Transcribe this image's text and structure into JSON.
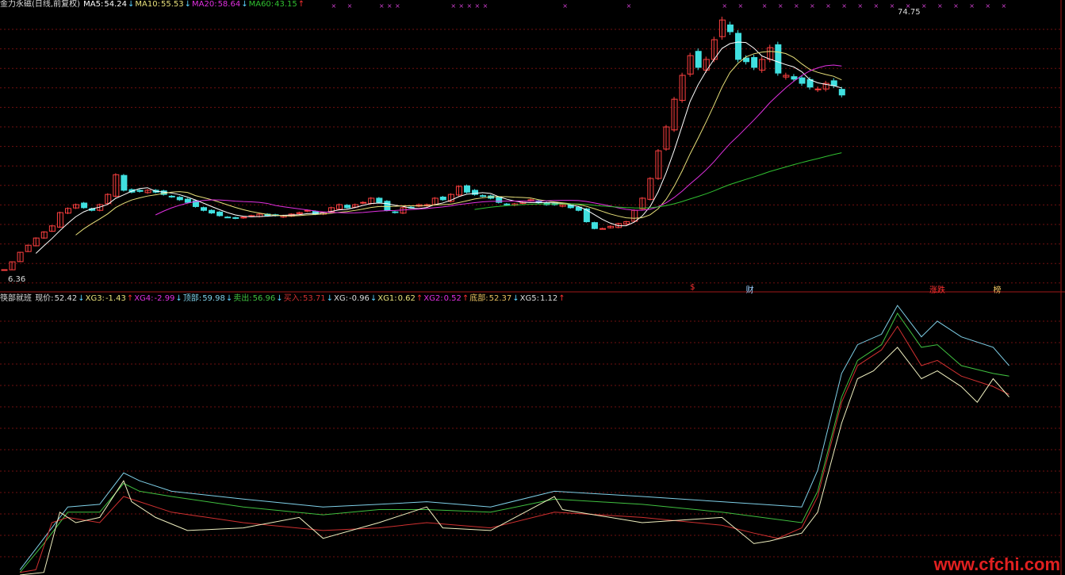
{
  "top_header": {
    "title": "金力永磁(日线,前复权)",
    "items": [
      {
        "label": "MA5:",
        "value": "54.24",
        "arrow": "↓",
        "color": "#ffffff",
        "arrow_color": "#5ad2ff"
      },
      {
        "label": "MA10:",
        "value": "55.53",
        "arrow": "↓",
        "color": "#e8e07a",
        "arrow_color": "#5ad2ff"
      },
      {
        "label": "MA20:",
        "value": "58.64",
        "arrow": "↓",
        "color": "#e030e0",
        "arrow_color": "#5ad2ff"
      },
      {
        "label": "MA60:",
        "value": "43.15",
        "arrow": "↑",
        "color": "#30c030",
        "arrow_color": "#ff3030"
      }
    ]
  },
  "bottom_header": {
    "title": "筷部就班",
    "items": [
      {
        "label": "现价:",
        "value": "52.42",
        "arrow": "↓",
        "color": "#dddddd",
        "arrow_color": "#5ad2ff"
      },
      {
        "label": "XG3:",
        "value": "-1.43",
        "arrow": "↑",
        "color": "#e8e07a",
        "arrow_color": "#ff3030"
      },
      {
        "label": "XG4:",
        "value": "-2.99",
        "arrow": "↓",
        "color": "#e030e0",
        "arrow_color": "#5ad2ff"
      },
      {
        "label": "顶部:",
        "value": "59.98",
        "arrow": "↓",
        "color": "#7fd0e8",
        "arrow_color": "#5ad2ff"
      },
      {
        "label": "卖出:",
        "value": "56.96",
        "arrow": "↓",
        "color": "#40c040",
        "arrow_color": "#5ad2ff"
      },
      {
        "label": "买入:",
        "value": "53.71",
        "arrow": "↓",
        "color": "#d03030",
        "arrow_color": "#5ad2ff"
      },
      {
        "label": "XG:",
        "value": "-0.96",
        "arrow": "↓",
        "color": "#dddddd",
        "arrow_color": "#5ad2ff"
      },
      {
        "label": "XG1:",
        "value": "0.62",
        "arrow": "↑",
        "color": "#e8e07a",
        "arrow_color": "#ff3030"
      },
      {
        "label": "XG2:",
        "value": "0.52",
        "arrow": "↑",
        "color": "#e030e0",
        "arrow_color": "#ff3030"
      },
      {
        "label": "底部:",
        "value": "52.37",
        "arrow": "↓",
        "color": "#e8c060",
        "arrow_color": "#5ad2ff"
      },
      {
        "label": "XG5:",
        "value": "1.12",
        "arrow": "↑",
        "color": "#dddddd",
        "arrow_color": "#ff3030"
      }
    ]
  },
  "tags": [
    {
      "text": "$",
      "color": "#ff3030",
      "index": 86
    },
    {
      "text": "财",
      "color": "#9fd0ff",
      "index": 93
    },
    {
      "text": "涨跌",
      "color": "#ff3030",
      "index": 116
    },
    {
      "text": "榜",
      "color": "#e8c060",
      "index": 124
    }
  ],
  "watermark": "www.cfchi.com",
  "chart_data": [
    {
      "type": "candlestick",
      "title": "金力永磁(日线,前复权)",
      "max_label": "74.75",
      "min_label": "6.36",
      "ylim": [
        6.36,
        74.75
      ],
      "closes": [
        6.36,
        8.43,
        10.94,
        12.8,
        14.7,
        16.3,
        17.9,
        21.4,
        22.5,
        23.5,
        22.7,
        22.0,
        23.5,
        26.2,
        31.4,
        27.3,
        26.8,
        27.0,
        27.3,
        26.8,
        26.2,
        25.6,
        24.8,
        24.1,
        23.0,
        22.0,
        21.3,
        20.6,
        20.2,
        19.9,
        20.2,
        20.6,
        21.0,
        20.6,
        20.6,
        20.6,
        21.0,
        21.4,
        22.0,
        21.0,
        21.4,
        22.7,
        23.5,
        22.7,
        23.5,
        24.1,
        25.2,
        24.1,
        22.0,
        21.4,
        22.7,
        22.7,
        23.5,
        23.5,
        25.2,
        24.8,
        26.2,
        28.3,
        26.8,
        26.2,
        25.8,
        25.2,
        24.1,
        23.5,
        23.7,
        24.1,
        24.8,
        24.0,
        23.5,
        23.5,
        23.5,
        22.7,
        22.0,
        19.0,
        17.2,
        17.2,
        17.8,
        18.5,
        19.0,
        22.0,
        25.2,
        30.4,
        37.7,
        44.0,
        51.3,
        57.6,
        62.8,
        59.7,
        61.8,
        67.0,
        72.2,
        69.1,
        61.8,
        61.2,
        59.7,
        61.8,
        64.9,
        58.2,
        57.6,
        56.6,
        55.5,
        54.5,
        54.0,
        55.5,
        54.9,
        52.42
      ],
      "series": [
        {
          "name": "MA5",
          "color": "#ffffff",
          "period": 5
        },
        {
          "name": "MA10",
          "color": "#e8e07a",
          "period": 10
        },
        {
          "name": "MA20",
          "color": "#e030e0",
          "period": 20
        },
        {
          "name": "MA60",
          "color": "#30c030",
          "period": 60
        }
      ]
    },
    {
      "type": "line",
      "title": "筷部就班",
      "ylim": [
        0,
        100
      ],
      "series": [
        {
          "name": "顶部",
          "color": "#7fd0e8",
          "points": [
            [
              2,
              2
            ],
            [
              5,
              14
            ],
            [
              8,
              26
            ],
            [
              12,
              27
            ],
            [
              15,
              39
            ],
            [
              17,
              36
            ],
            [
              21,
              32
            ],
            [
              30,
              29
            ],
            [
              40,
              26
            ],
            [
              47,
              27
            ],
            [
              53,
              28
            ],
            [
              61,
              26
            ],
            [
              69,
              32
            ],
            [
              80,
              30
            ],
            [
              90,
              28
            ],
            [
              100,
              26
            ],
            [
              102,
              40
            ],
            [
              105,
              77
            ],
            [
              107,
              88
            ],
            [
              110,
              92
            ],
            [
              112,
              103
            ],
            [
              115,
              91
            ],
            [
              117,
              97
            ],
            [
              120,
              91
            ],
            [
              124,
              87
            ],
            [
              126,
              80
            ]
          ]
        },
        {
          "name": "卖出",
          "color": "#40c040",
          "points": [
            [
              2,
              1
            ],
            [
              5,
              12
            ],
            [
              8,
              24
            ],
            [
              12,
              24
            ],
            [
              15,
              35
            ],
            [
              17,
              32
            ],
            [
              21,
              30
            ],
            [
              30,
              26
            ],
            [
              40,
              23
            ],
            [
              47,
              25
            ],
            [
              53,
              25
            ],
            [
              61,
              24
            ],
            [
              69,
              29
            ],
            [
              80,
              27
            ],
            [
              90,
              24
            ],
            [
              100,
              20
            ],
            [
              102,
              32
            ],
            [
              105,
              68
            ],
            [
              107,
              82
            ],
            [
              110,
              88
            ],
            [
              112,
              100
            ],
            [
              115,
              87
            ],
            [
              117,
              88
            ],
            [
              120,
              80
            ],
            [
              124,
              77
            ],
            [
              126,
              76
            ]
          ]
        },
        {
          "name": "买入",
          "color": "#d03030",
          "points": [
            [
              2,
              1
            ],
            [
              4,
              2
            ],
            [
              6,
              20
            ],
            [
              8,
              22
            ],
            [
              12,
              20
            ],
            [
              15,
              30
            ],
            [
              17,
              28
            ],
            [
              21,
              24
            ],
            [
              30,
              20
            ],
            [
              40,
              17
            ],
            [
              47,
              18
            ],
            [
              53,
              20
            ],
            [
              61,
              18
            ],
            [
              69,
              24
            ],
            [
              80,
              22
            ],
            [
              90,
              19
            ],
            [
              94,
              16
            ],
            [
              97,
              14
            ],
            [
              100,
              18
            ],
            [
              102,
              30
            ],
            [
              105,
              66
            ],
            [
              107,
              80
            ],
            [
              110,
              86
            ],
            [
              112,
              95
            ],
            [
              115,
              80
            ],
            [
              117,
              82
            ],
            [
              120,
              76
            ],
            [
              124,
              72
            ],
            [
              126,
              69
            ]
          ]
        },
        {
          "name": "XG",
          "color": "#f0f0c0",
          "points": [
            [
              2,
              0
            ],
            [
              5,
              1
            ],
            [
              7,
              24
            ],
            [
              9,
              20
            ],
            [
              12,
              22
            ],
            [
              15,
              36
            ],
            [
              16,
              28
            ],
            [
              19,
              22
            ],
            [
              23,
              17
            ],
            [
              30,
              18
            ],
            [
              37,
              22
            ],
            [
              40,
              14
            ],
            [
              47,
              20
            ],
            [
              53,
              26
            ],
            [
              55,
              18
            ],
            [
              61,
              17
            ],
            [
              69,
              30
            ],
            [
              70,
              25
            ],
            [
              80,
              20
            ],
            [
              90,
              22
            ],
            [
              94,
              12
            ],
            [
              96,
              13
            ],
            [
              100,
              16
            ],
            [
              102,
              24
            ],
            [
              105,
              58
            ],
            [
              107,
              75
            ],
            [
              109,
              78
            ],
            [
              112,
              87
            ],
            [
              115,
              75
            ],
            [
              117,
              78
            ],
            [
              120,
              72
            ],
            [
              122,
              66
            ],
            [
              124,
              75
            ],
            [
              126,
              68
            ]
          ]
        }
      ]
    }
  ]
}
